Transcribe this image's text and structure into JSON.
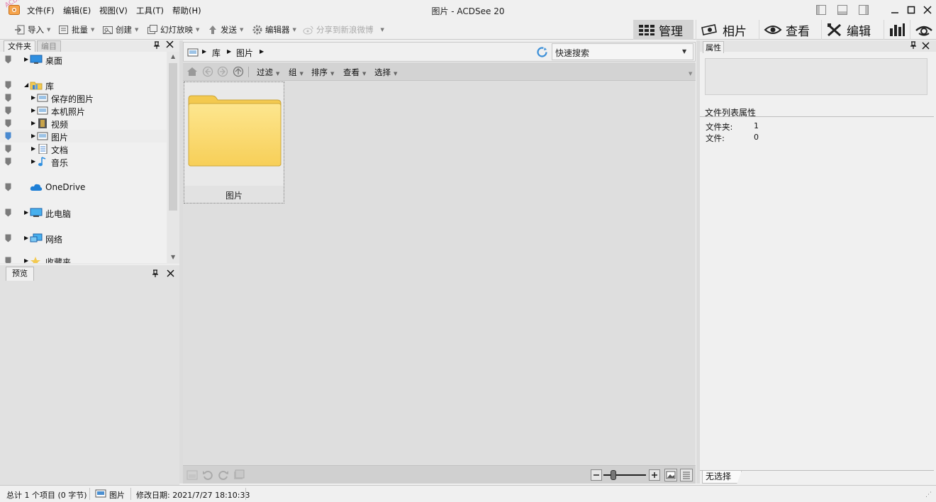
{
  "window": {
    "title": "图片 - ACDSee 20",
    "watermark": "ACDSee教程"
  },
  "menu": [
    "文件(F)",
    "编辑(E)",
    "视图(V)",
    "工具(T)",
    "帮助(H)"
  ],
  "toolbar": {
    "import": "导入",
    "batch": "批量",
    "create": "创建",
    "slideshow": "幻灯放映",
    "send": "发送",
    "editor": "编辑器",
    "share": "分享到新浪微博"
  },
  "modes": {
    "manage": "管理",
    "photos": "相片",
    "view": "查看",
    "edit": "编辑"
  },
  "folder_panel": {
    "tabs": [
      "文件夹",
      "编目"
    ],
    "items": [
      {
        "label": "桌面"
      },
      {
        "label": "库"
      },
      {
        "label": "保存的图片"
      },
      {
        "label": "本机照片"
      },
      {
        "label": "视频"
      },
      {
        "label": "图片",
        "selected": true
      },
      {
        "label": "文档"
      },
      {
        "label": "音乐"
      },
      {
        "label": "OneDrive"
      },
      {
        "label": "此电脑"
      },
      {
        "label": "网络"
      },
      {
        "label": "收藏夹"
      }
    ]
  },
  "preview_panel": {
    "tab": "预览"
  },
  "address": {
    "crumbs": [
      "库",
      "图片"
    ],
    "search_placeholder": "快速搜索"
  },
  "filterbar": {
    "filter": "过滤",
    "group": "组",
    "sort": "排序",
    "view": "查看",
    "select": "选择"
  },
  "files": [
    {
      "name": "图片",
      "type": "folder"
    }
  ],
  "zoom_level": 0.2,
  "properties": {
    "tab": "属性",
    "section": "文件列表属性",
    "folders_label": "文件夹:",
    "folders_value": "1",
    "files_label": "文件:",
    "files_value": "0",
    "bottom_tab": "无选择"
  },
  "status": {
    "total": "总计 1 个项目 (0 字节)",
    "location": "图片",
    "modified": "修改日期: 2021/7/27 18:10:33"
  },
  "colors": {
    "folder_fill": "#fbd871",
    "folder_tab": "#f3c94f",
    "accent": "#2b7fd4"
  }
}
